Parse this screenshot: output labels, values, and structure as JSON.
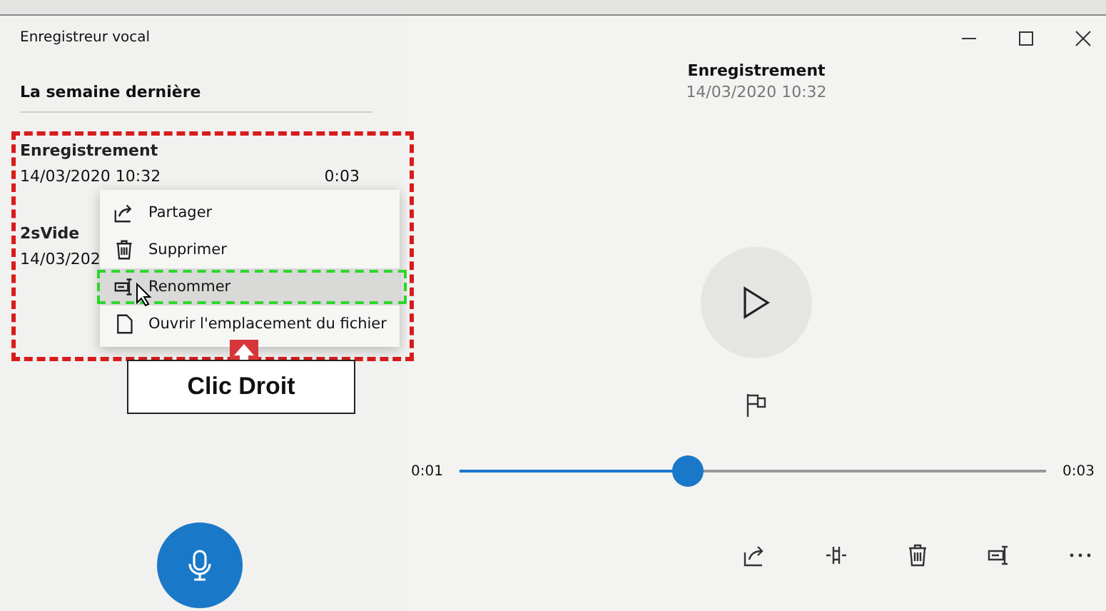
{
  "window": {
    "title": "Enregistreur vocal"
  },
  "list": {
    "group": "La semaine dernière",
    "items": [
      {
        "name": "Enregistrement",
        "date": "14/03/2020 10:32",
        "duration": "0:03"
      },
      {
        "name": "2sVide",
        "date": "14/03/202"
      }
    ]
  },
  "context_menu": {
    "items": [
      {
        "label": "Partager",
        "selected": false
      },
      {
        "label": "Supprimer",
        "selected": false
      },
      {
        "label": "Renommer",
        "selected": true
      },
      {
        "label": "Ouvrir l'emplacement du fichier",
        "selected": false
      }
    ]
  },
  "annotation": {
    "callout": "Clic Droit"
  },
  "player": {
    "title": "Enregistrement",
    "date": "14/03/2020 10:32",
    "elapsed": "0:01",
    "total": "0:03",
    "level": 0.39
  }
}
